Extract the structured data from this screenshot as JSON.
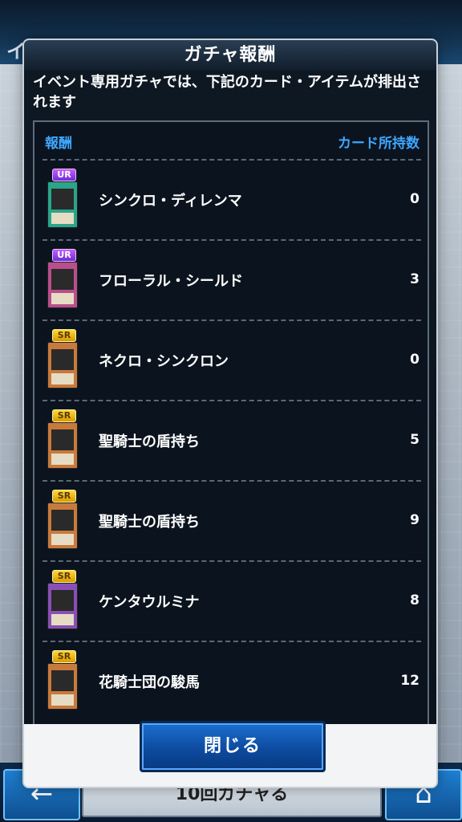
{
  "background": {
    "title": "イベント",
    "bottom_button": "10回ガチャる",
    "left_button_icon": "back-arrow-icon",
    "right_button_icon": "home-icon"
  },
  "dialog": {
    "title": "ガチャ報酬",
    "description": "イベント専用ガチャでは、下記のカード・アイテムが排出されます",
    "list_header": {
      "left": "報酬",
      "right": "カード所持数"
    },
    "rows": [
      {
        "rarity": "UR",
        "name": "シンクロ・ディレンマ",
        "count": "0",
        "card_icon": "synchro-card-icon"
      },
      {
        "rarity": "UR",
        "name": "フローラル・シールド",
        "count": "3",
        "card_icon": "trap-card-icon"
      },
      {
        "rarity": "SR",
        "name": "ネクロ・シンクロン",
        "count": "0",
        "card_icon": "effect-monster-card-icon"
      },
      {
        "rarity": "SR",
        "name": "聖騎士の盾持ち",
        "count": "5",
        "card_icon": "effect-monster-card-icon"
      },
      {
        "rarity": "SR",
        "name": "聖騎士の盾持ち",
        "count": "9",
        "card_icon": "effect-monster-card-icon"
      },
      {
        "rarity": "SR",
        "name": "ケンタウルミナ",
        "count": "8",
        "card_icon": "fusion-monster-card-icon"
      },
      {
        "rarity": "SR",
        "name": "花騎士団の駿馬",
        "count": "12",
        "card_icon": "effect-monster-card-icon"
      }
    ],
    "close_label": "閉じる"
  },
  "colors": {
    "header_text": "#3fa7ff",
    "ur_badge": "#8a3fe6",
    "sr_badge": "#f0c020",
    "close_button": "#1c6fd0"
  }
}
